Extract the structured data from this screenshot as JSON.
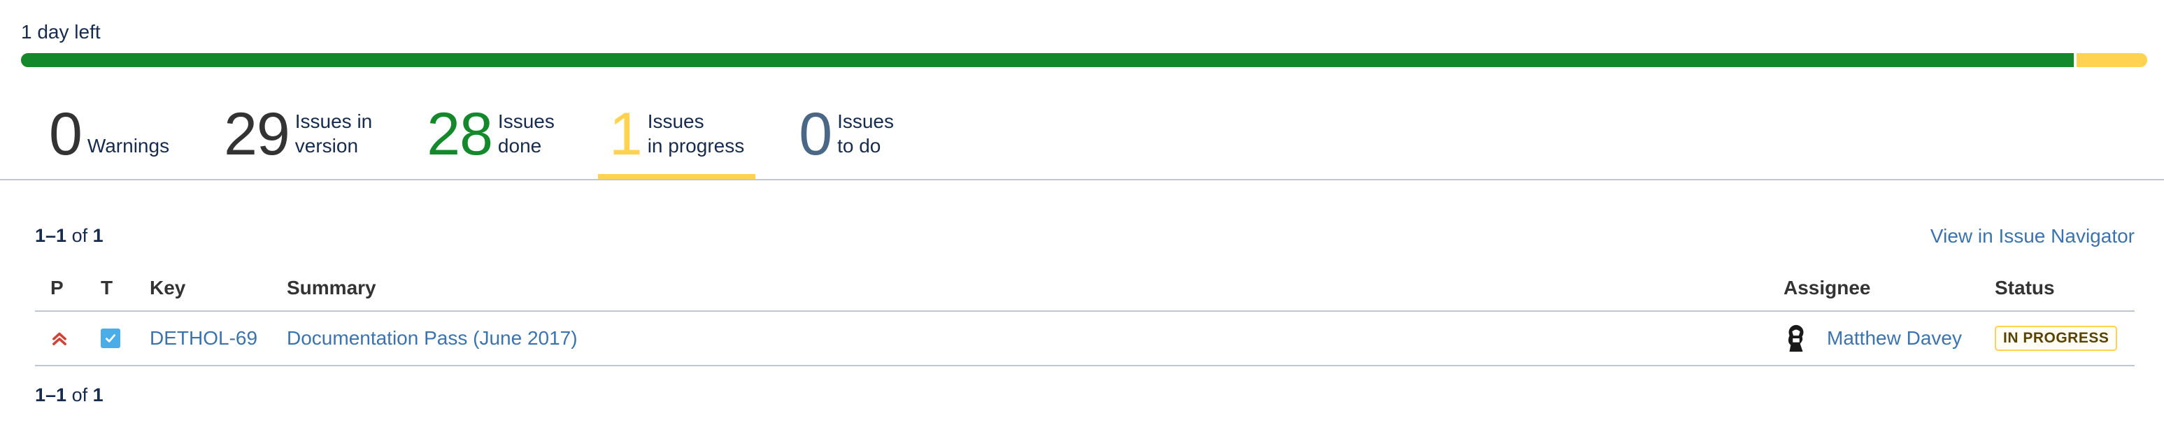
{
  "sprint": {
    "days_left": "1 day left",
    "progress": {
      "done": 28,
      "in_progress": 1,
      "to_do": 0,
      "total": 29
    }
  },
  "stats": {
    "warnings": {
      "value": "0",
      "label": "Warnings"
    },
    "issues_in_version": {
      "value": "29",
      "label": "Issues in\nversion"
    },
    "issues_done": {
      "value": "28",
      "label": "Issues\ndone"
    },
    "issues_in_progress": {
      "value": "1",
      "label": "Issues\nin progress"
    },
    "issues_to_do": {
      "value": "0",
      "label": "Issues\nto do"
    },
    "active_tab": "issues_in_progress"
  },
  "pager": {
    "range": "1–1",
    "of_word": " of ",
    "total": "1"
  },
  "view_in_navigator": "View in Issue Navigator",
  "table": {
    "headers": {
      "p": "P",
      "t": "T",
      "key": "Key",
      "summary": "Summary",
      "assignee": "Assignee",
      "status": "Status"
    },
    "rows": [
      {
        "priority_icon": "chevron-double-up-icon",
        "type_icon": "task-checkbox-icon",
        "key": "DETHOL-69",
        "summary": "Documentation Pass (June 2017)",
        "assignee": "Matthew Davey",
        "status": "IN PROGRESS"
      }
    ]
  },
  "colors": {
    "done": "#14892c",
    "in_progress": "#ffd351",
    "to_do": "#4a6785",
    "link": "#3b73af",
    "priority": "#d04437",
    "type": "#4bade8"
  }
}
